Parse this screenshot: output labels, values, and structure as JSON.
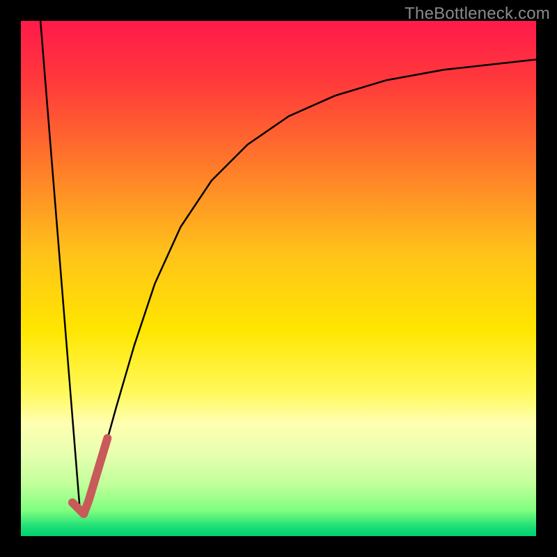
{
  "watermark_text": "TheBottleneck.com",
  "chart_data": {
    "type": "line",
    "title": "",
    "xlabel": "",
    "ylabel": "",
    "xlim": [
      0,
      100
    ],
    "ylim": [
      0,
      100
    ],
    "background_gradient": {
      "stops": [
        {
          "offset": 0.0,
          "color": "#ff1a4b"
        },
        {
          "offset": 0.12,
          "color": "#ff3a3a"
        },
        {
          "offset": 0.28,
          "color": "#ff7a2a"
        },
        {
          "offset": 0.45,
          "color": "#ffc21a"
        },
        {
          "offset": 0.6,
          "color": "#ffe600"
        },
        {
          "offset": 0.72,
          "color": "#fff95a"
        },
        {
          "offset": 0.78,
          "color": "#ffffb0"
        },
        {
          "offset": 0.84,
          "color": "#e8ffb0"
        },
        {
          "offset": 0.9,
          "color": "#c0ff9a"
        },
        {
          "offset": 0.95,
          "color": "#80ff80"
        },
        {
          "offset": 0.98,
          "color": "#22e077"
        },
        {
          "offset": 1.0,
          "color": "#00d070"
        }
      ]
    },
    "series": [
      {
        "name": "curve-left",
        "stroke": "#000000",
        "stroke_width": 2.5,
        "points": [
          {
            "x": 3.8,
            "y": 100.0
          },
          {
            "x": 11.5,
            "y": 4.5
          }
        ]
      },
      {
        "name": "curve-right",
        "stroke": "#000000",
        "stroke_width": 2.5,
        "points": [
          {
            "x": 11.5,
            "y": 4.5
          },
          {
            "x": 12.5,
            "y": 6.0
          },
          {
            "x": 14.0,
            "y": 9.5
          },
          {
            "x": 16.0,
            "y": 16.0
          },
          {
            "x": 18.5,
            "y": 25.0
          },
          {
            "x": 22.0,
            "y": 37.0
          },
          {
            "x": 26.0,
            "y": 49.0
          },
          {
            "x": 31.0,
            "y": 60.0
          },
          {
            "x": 37.0,
            "y": 69.0
          },
          {
            "x": 44.0,
            "y": 76.0
          },
          {
            "x": 52.0,
            "y": 81.5
          },
          {
            "x": 61.0,
            "y": 85.5
          },
          {
            "x": 71.0,
            "y": 88.5
          },
          {
            "x": 82.0,
            "y": 90.5
          },
          {
            "x": 100.0,
            "y": 92.5
          }
        ]
      },
      {
        "name": "highlight-segment",
        "stroke": "#c85a5a",
        "stroke_width": 12,
        "linecap": "round",
        "points": [
          {
            "x": 10.0,
            "y": 6.5
          },
          {
            "x": 12.2,
            "y": 4.3
          },
          {
            "x": 13.2,
            "y": 7.0
          },
          {
            "x": 14.4,
            "y": 11.0
          },
          {
            "x": 15.6,
            "y": 15.0
          },
          {
            "x": 16.8,
            "y": 19.0
          }
        ]
      }
    ]
  }
}
